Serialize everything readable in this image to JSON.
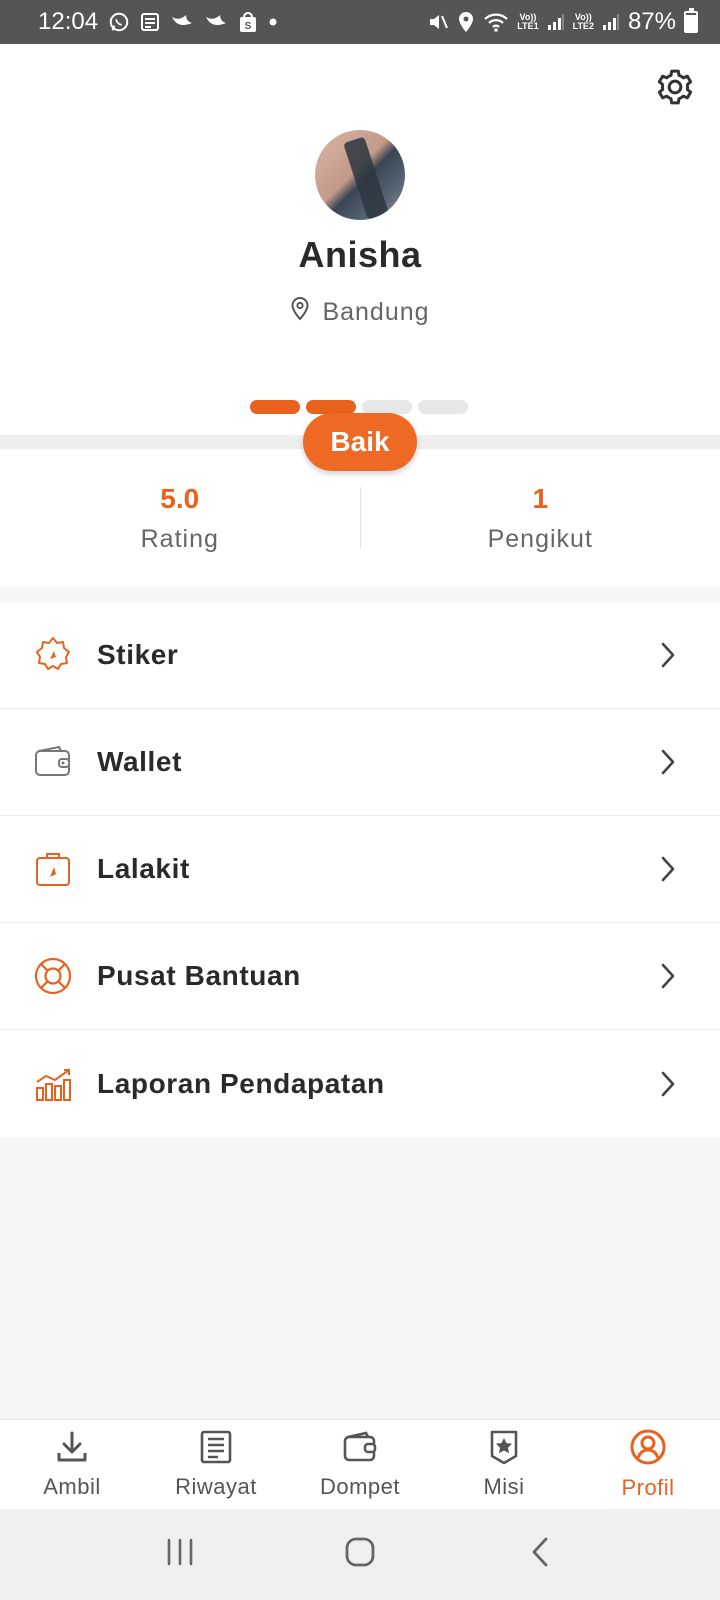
{
  "status_bar": {
    "time": "12:04",
    "battery": "87%",
    "lte1": "LTE1",
    "lte2": "LTE2",
    "volte": "Vo))"
  },
  "profile": {
    "name": "Anisha",
    "location": "Bandung",
    "level_progress": 0.5,
    "level_badge": "Baik"
  },
  "stats": [
    {
      "value": "5.0",
      "label": "Rating"
    },
    {
      "value": "1",
      "label": "Pengikut"
    }
  ],
  "menu": [
    {
      "label": "Stiker",
      "icon": "sticker-icon"
    },
    {
      "label": "Wallet",
      "icon": "wallet-icon"
    },
    {
      "label": "Lalakit",
      "icon": "bag-icon"
    },
    {
      "label": "Pusat Bantuan",
      "icon": "lifebuoy-icon"
    },
    {
      "label": "Laporan Pendapatan",
      "icon": "chart-icon"
    }
  ],
  "bottom_nav": [
    {
      "label": "Ambil",
      "icon": "download-icon"
    },
    {
      "label": "Riwayat",
      "icon": "history-icon"
    },
    {
      "label": "Dompet",
      "icon": "wallet-icon"
    },
    {
      "label": "Misi",
      "icon": "mission-star-icon"
    },
    {
      "label": "Profil",
      "icon": "profile-icon",
      "active": true
    }
  ],
  "colors": {
    "accent": "#e8621e",
    "text": "#2a2a2a",
    "muted": "#666666",
    "status_bar": "#555555"
  }
}
